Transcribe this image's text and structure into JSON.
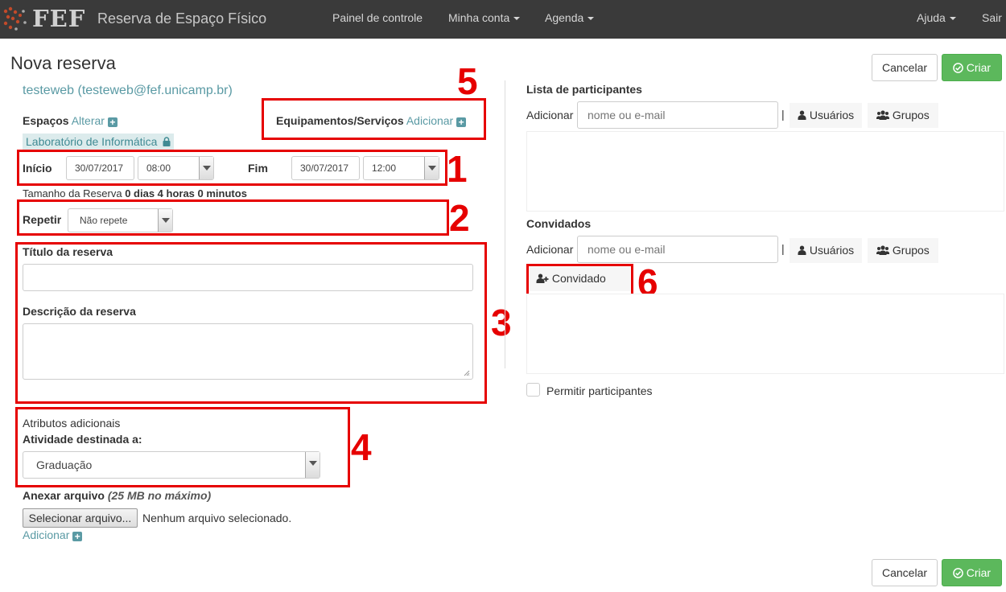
{
  "navbar": {
    "logo": "FEF",
    "brand": "Reserva de Espaço Físico",
    "items": [
      "Painel de controle",
      "Minha conta",
      "Agenda"
    ],
    "help": "Ajuda",
    "logout": "Sair"
  },
  "page": {
    "title": "Nova reserva",
    "user": "testeweb (testeweb@fef.unicamp.br)"
  },
  "actions": {
    "cancel": "Cancelar",
    "create": "Criar"
  },
  "spaces": {
    "label": "Espaços",
    "change": "Alterar",
    "selected": "Laboratório de Informática"
  },
  "equipment": {
    "label": "Equipamentos/Serviços",
    "add": "Adicionar"
  },
  "schedule": {
    "start_label": "Início",
    "start_date": "30/07/2017",
    "start_time": "08:00",
    "end_label": "Fim",
    "end_date": "30/07/2017",
    "end_time": "12:00",
    "size_label": "Tamanho da Reserva",
    "size_value": "0 dias 4 horas 0 minutos"
  },
  "repeat": {
    "label": "Repetir",
    "value": "Não repete"
  },
  "details": {
    "title_label": "Título da reserva",
    "title_value": "",
    "desc_label": "Descrição da reserva",
    "desc_value": ""
  },
  "attributes": {
    "heading": "Atributos adicionais",
    "activity_label": "Atividade destinada a:",
    "activity_value": "Graduação"
  },
  "attachment": {
    "label": "Anexar arquivo",
    "note": "(25 MB no máximo)",
    "button": "Selecionar arquivo...",
    "status": "Nenhum arquivo selecionado.",
    "add": "Adicionar"
  },
  "participants": {
    "heading": "Lista de participantes",
    "add_label": "Adicionar",
    "placeholder": "nome ou e-mail",
    "users": "Usuários",
    "groups": "Grupos"
  },
  "guests": {
    "heading": "Convidados",
    "add_label": "Adicionar",
    "placeholder": "nome ou e-mail",
    "users": "Usuários",
    "groups": "Grupos",
    "guest_button": "Convidado"
  },
  "allow_participants": "Permitir participantes",
  "annotations": [
    "1",
    "2",
    "3",
    "4",
    "5",
    "6"
  ],
  "colors": {
    "navbar": "#3a3a3a",
    "link": "#5a9aa4",
    "success": "#5cb85c",
    "annotation": "#e60000"
  }
}
